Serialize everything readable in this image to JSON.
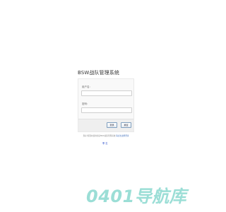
{
  "app": {
    "title": "BSW战队管理系统"
  },
  "login": {
    "username_label": "用户名:",
    "username_value": "",
    "password_label": "密码:",
    "password_value": "",
    "login_button": "登录",
    "reset_button": "重置"
  },
  "footer": {
    "note": "您好!您现在使用的是BSW战队管理系统 ",
    "link": "请点击这里登录",
    "brand": "季 志"
  },
  "watermark": {
    "text": "0401导航库"
  },
  "colors": {
    "background": "#ffffff",
    "panel": "#f9f9f9",
    "link": "#2b5fb3",
    "watermark": "#9bded6"
  }
}
